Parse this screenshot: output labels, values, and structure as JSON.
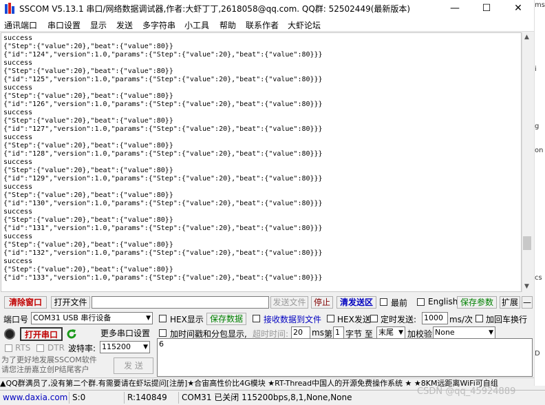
{
  "title": {
    "text": "SSCOM V5.13.1 串口/网络数据调试器,作者:大虾丁丁,2618058@qq.com. QQ群: 52502449(最新版本)",
    "minimize": "—",
    "maximize": "☐",
    "close": "✕"
  },
  "menu": [
    "通讯端口",
    "串口设置",
    "显示",
    "发送",
    "多字符串",
    "小工具",
    "帮助",
    "联系作者",
    "大虾论坛"
  ],
  "receive": {
    "lines": [
      "success",
      "{\"Step\":{\"value\":20},\"beat\":{\"value\":80}}",
      "{\"id\":\"124\",\"version\":1.0,\"params\":{\"Step\":{\"value\":20},\"beat\":{\"value\":80}}}",
      "success",
      "{\"Step\":{\"value\":20},\"beat\":{\"value\":80}}",
      "{\"id\":\"125\",\"version\":1.0,\"params\":{\"Step\":{\"value\":20},\"beat\":{\"value\":80}}}",
      "success",
      "{\"Step\":{\"value\":20},\"beat\":{\"value\":80}}",
      "{\"id\":\"126\",\"version\":1.0,\"params\":{\"Step\":{\"value\":20},\"beat\":{\"value\":80}}}",
      "success",
      "{\"Step\":{\"value\":20},\"beat\":{\"value\":80}}",
      "{\"id\":\"127\",\"version\":1.0,\"params\":{\"Step\":{\"value\":20},\"beat\":{\"value\":80}}}",
      "success",
      "{\"Step\":{\"value\":20},\"beat\":{\"value\":80}}",
      "{\"id\":\"128\",\"version\":1.0,\"params\":{\"Step\":{\"value\":20},\"beat\":{\"value\":80}}}",
      "success",
      "{\"Step\":{\"value\":20},\"beat\":{\"value\":80}}",
      "{\"id\":\"129\",\"version\":1.0,\"params\":{\"Step\":{\"value\":20},\"beat\":{\"value\":80}}}",
      "success",
      "{\"Step\":{\"value\":20},\"beat\":{\"value\":80}}",
      "{\"id\":\"130\",\"version\":1.0,\"params\":{\"Step\":{\"value\":20},\"beat\":{\"value\":80}}}",
      "success",
      "{\"Step\":{\"value\":20},\"beat\":{\"value\":80}}",
      "{\"id\":\"131\",\"version\":1.0,\"params\":{\"Step\":{\"value\":20},\"beat\":{\"value\":80}}}",
      "success",
      "{\"Step\":{\"value\":20},\"beat\":{\"value\":80}}",
      "{\"id\":\"132\",\"version\":1.0,\"params\":{\"Step\":{\"value\":20},\"beat\":{\"value\":80}}}",
      "success",
      "{\"Step\":{\"value\":20},\"beat\":{\"value\":80}}",
      "{\"id\":\"133\",\"version\":1.0,\"params\":{\"Step\":{\"value\":20},\"beat\":{\"value\":80}}}"
    ]
  },
  "toolbar": {
    "clear_window": "清除窗口",
    "open_file": "打开文件",
    "file_path": "",
    "send_file": "发送文件",
    "stop": "停止",
    "clear_send": "清发送区",
    "topmost": "最前",
    "english": "English",
    "save_params": "保存参数",
    "expand": "扩展",
    "collapse": "—"
  },
  "port": {
    "label": "端口号",
    "value": "COM31 USB 串行设备",
    "open_button": "打开串口",
    "more_settings": "更多串口设置",
    "rts": "RTS",
    "dtr": "DTR",
    "baud_label": "波特率:",
    "baud_value": "115200"
  },
  "options": {
    "hex_display": "HEX显示",
    "save_data": "保存数据",
    "recv_to_file": "接收数据到文件",
    "hex_send": "HEX发送",
    "timed_send": "定时发送:",
    "interval_value": "1000",
    "interval_unit": "ms/次",
    "add_crlf": "加回车换行",
    "timestamp": "加时间戳和分包显示,",
    "timeout_label": "超时时间:",
    "timeout_value": "20",
    "timeout_unit": "ms",
    "nth_label": "第",
    "nth_value": "1",
    "byte_label": "字节 至",
    "end_value": "末尾",
    "checksum_label": "加校验",
    "checksum_value": "None"
  },
  "promo": "为了更好地发展SSCOM软件\n请您注册嘉立创P结尾客户",
  "send_button": "发 送",
  "send_text": "6",
  "marquee": "▲QQ群满员了,没有第二个群.有需要请在虾坛提问[注册]★合宙高性价比4G模块 ★RT-Thread中国人的开源免费操作系统 ★ ★8KM远距离WiFi可自组",
  "status": {
    "url": "www.daxia.com",
    "sent": "S:0",
    "received": "R:140849",
    "port_state": "COM31 已关闭  115200bps,8,1,None,None"
  },
  "side_texts": [
    "ms",
    "i",
    "g",
    "on",
    "cs",
    "D"
  ],
  "watermark": "CSDN @qq_45924889",
  "colors": {
    "accent_red": "#c00000",
    "accent_green": "#008000",
    "accent_blue": "#0000c0"
  }
}
